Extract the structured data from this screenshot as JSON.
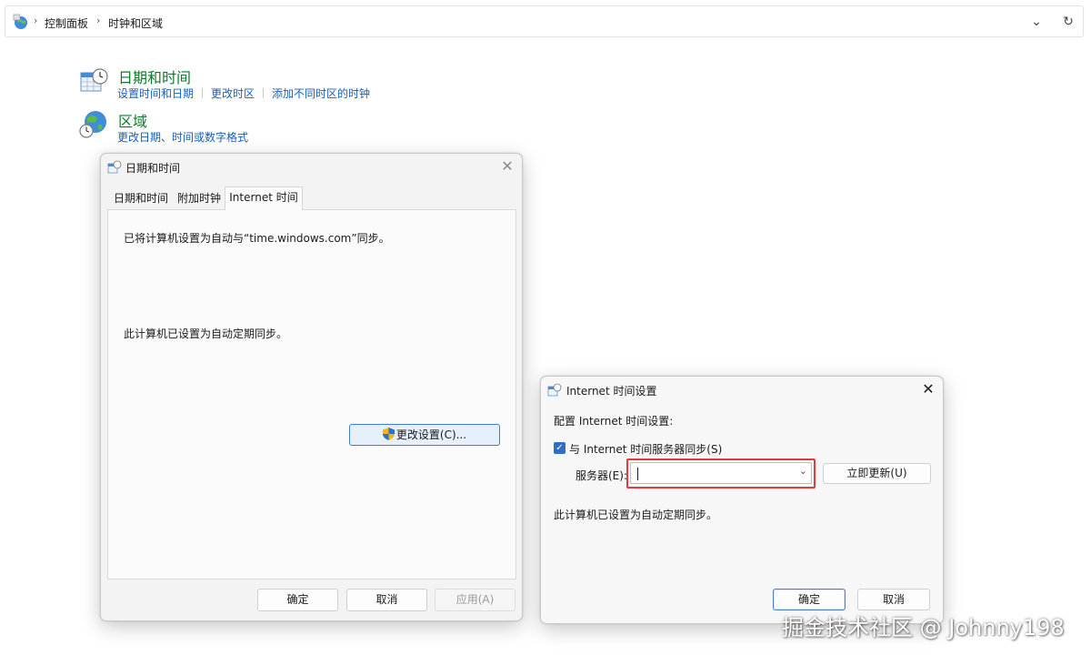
{
  "address_bar": {
    "breadcrumbs": [
      "控制面板",
      "时钟和区域"
    ],
    "dropdown_icon": "chevron-down",
    "refresh_icon": "refresh"
  },
  "categories": [
    {
      "title": "日期和时间",
      "icon": "calendar-clock",
      "links": [
        "设置时间和日期",
        "更改时区",
        "添加不同时区的时钟"
      ]
    },
    {
      "title": "区域",
      "icon": "globe-clock",
      "links": [
        "更改日期、时间或数字格式"
      ]
    }
  ],
  "datetime_dialog": {
    "title": "日期和时间",
    "tabs": [
      "日期和时间",
      "附加时钟",
      "Internet 时间"
    ],
    "active_tab": "Internet 时间",
    "sync_status": "已将计算机设置为自动与“time.windows.com”同步。",
    "sync_schedule": "此计算机已设置为自动定期同步。",
    "change_settings_button": "更改设置(C)...",
    "ok_button": "确定",
    "cancel_button": "取消",
    "apply_button": "应用(A)"
  },
  "internet_time_dialog": {
    "title": "Internet 时间设置",
    "heading": "配置 Internet 时间设置:",
    "sync_checkbox_label": "与 Internet 时间服务器同步(S)",
    "sync_checked": true,
    "server_label": "服务器(E):",
    "server_value": "",
    "update_now_button": "立即更新(U)",
    "status_text": "此计算机已设置为自动定期同步。",
    "ok_button": "确定",
    "cancel_button": "取消"
  },
  "watermark": "掘金技术社区 @ Johnny198",
  "colors": {
    "link": "#1560bd",
    "category_title": "#0e7a2a",
    "highlight_border": "#e23b3b",
    "checkbox": "#2f6fc3"
  }
}
